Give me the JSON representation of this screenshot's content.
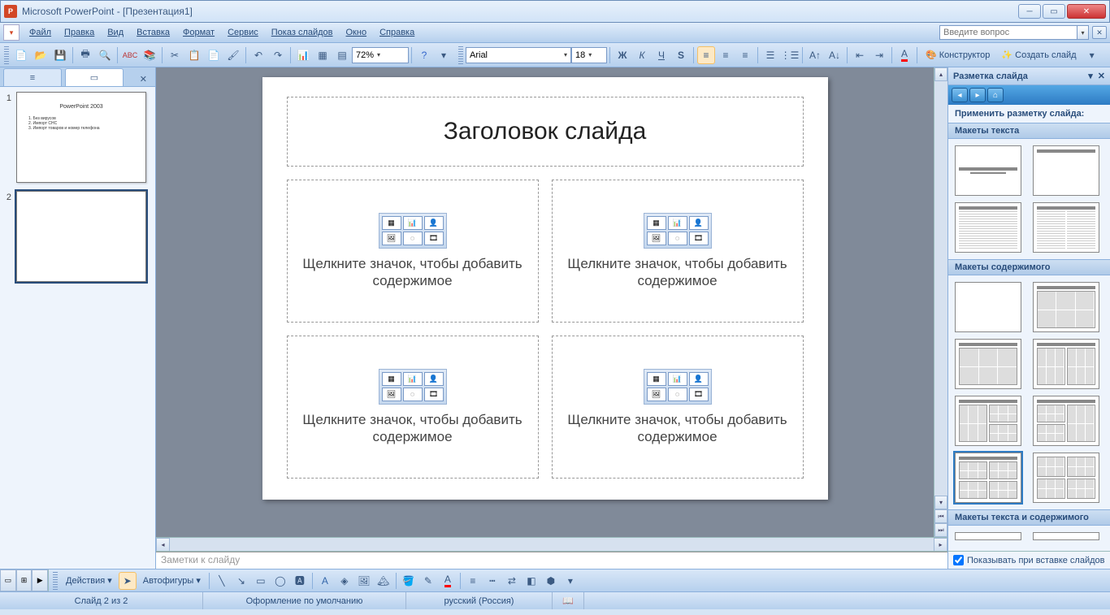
{
  "window": {
    "title": "Microsoft PowerPoint - [Презентация1]"
  },
  "menu": {
    "file": "Файл",
    "edit": "Правка",
    "view": "Вид",
    "insert": "Вставка",
    "format": "Формат",
    "tools": "Сервис",
    "slideshow": "Показ слайдов",
    "window": "Окно",
    "help": "Справка",
    "question_placeholder": "Введите вопрос"
  },
  "toolbar": {
    "zoom": "72%",
    "font": "Arial",
    "font_size": "18",
    "designer": "Конструктор",
    "new_slide": "Создать слайд"
  },
  "thumbs": {
    "slide1": {
      "num": "1",
      "title": "PowerPoint 2003",
      "item1": "1. Без вирусов",
      "item2": "2. Импорт СНС",
      "item3": "3. Импорт товаров и номер телефона"
    },
    "slide2": {
      "num": "2"
    }
  },
  "slide": {
    "title_ph": "Заголовок слайда",
    "content_ph": "Щелкните значок, чтобы добавить содержимое"
  },
  "notes": {
    "placeholder": "Заметки к слайду"
  },
  "taskpane": {
    "title": "Разметка слайда",
    "apply_label": "Применить разметку слайда:",
    "section_text": "Макеты текста",
    "section_content": "Макеты содержимого",
    "section_text_content": "Макеты текста и содержимого",
    "show_on_insert": "Показывать при вставке слайдов"
  },
  "drawbar": {
    "actions": "Действия",
    "autoshapes": "Автофигуры"
  },
  "status": {
    "slide": "Слайд 2 из 2",
    "design": "Оформление по умолчанию",
    "lang": "русский (Россия)"
  }
}
